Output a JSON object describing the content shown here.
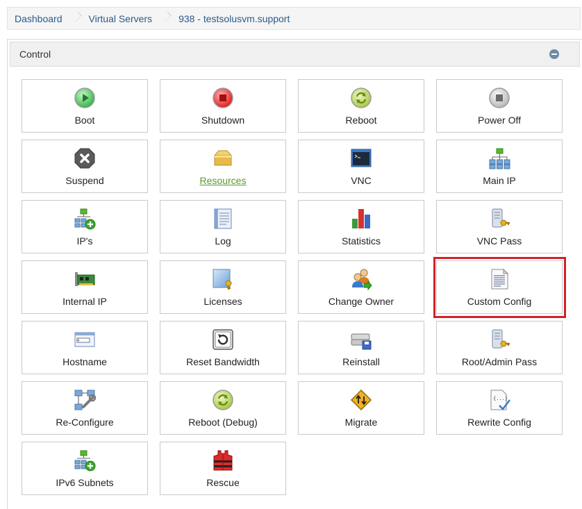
{
  "breadcrumb": {
    "items": [
      "Dashboard",
      "Virtual Servers",
      "938 - testsolusvm.support"
    ]
  },
  "panel": {
    "title": "Control"
  },
  "tiles": [
    {
      "label": "Boot",
      "icon": "boot-icon"
    },
    {
      "label": "Shutdown",
      "icon": "shutdown-icon"
    },
    {
      "label": "Reboot",
      "icon": "reboot-icon"
    },
    {
      "label": "Power Off",
      "icon": "power-off-icon"
    },
    {
      "label": "Suspend",
      "icon": "suspend-icon"
    },
    {
      "label": "Resources",
      "icon": "resources-icon"
    },
    {
      "label": "VNC",
      "icon": "vnc-icon"
    },
    {
      "label": "Main IP",
      "icon": "main-ip-icon"
    },
    {
      "label": "IP's",
      "icon": "ips-icon"
    },
    {
      "label": "Log",
      "icon": "log-icon"
    },
    {
      "label": "Statistics",
      "icon": "statistics-icon"
    },
    {
      "label": "VNC Pass",
      "icon": "vnc-pass-icon"
    },
    {
      "label": "Internal IP",
      "icon": "internal-ip-icon"
    },
    {
      "label": "Licenses",
      "icon": "licenses-icon"
    },
    {
      "label": "Change Owner",
      "icon": "change-owner-icon"
    },
    {
      "label": "Custom Config",
      "icon": "custom-config-icon"
    },
    {
      "label": "Hostname",
      "icon": "hostname-icon"
    },
    {
      "label": "Reset Bandwidth",
      "icon": "reset-bandwidth-icon"
    },
    {
      "label": "Reinstall",
      "icon": "reinstall-icon"
    },
    {
      "label": "Root/Admin Pass",
      "icon": "root-admin-pass-icon"
    },
    {
      "label": "Re-Configure",
      "icon": "re-configure-icon"
    },
    {
      "label": "Reboot (Debug)",
      "icon": "reboot-debug-icon"
    },
    {
      "label": "Migrate",
      "icon": "migrate-icon"
    },
    {
      "label": "Rewrite Config",
      "icon": "rewrite-config-icon"
    },
    {
      "label": "IPv6 Subnets",
      "icon": "ipv6-subnets-icon"
    },
    {
      "label": "Rescue",
      "icon": "rescue-icon"
    }
  ],
  "colors": {
    "link": "#2a5a8a",
    "resources_link": "#5a9a2a",
    "highlight": "#d42128"
  }
}
